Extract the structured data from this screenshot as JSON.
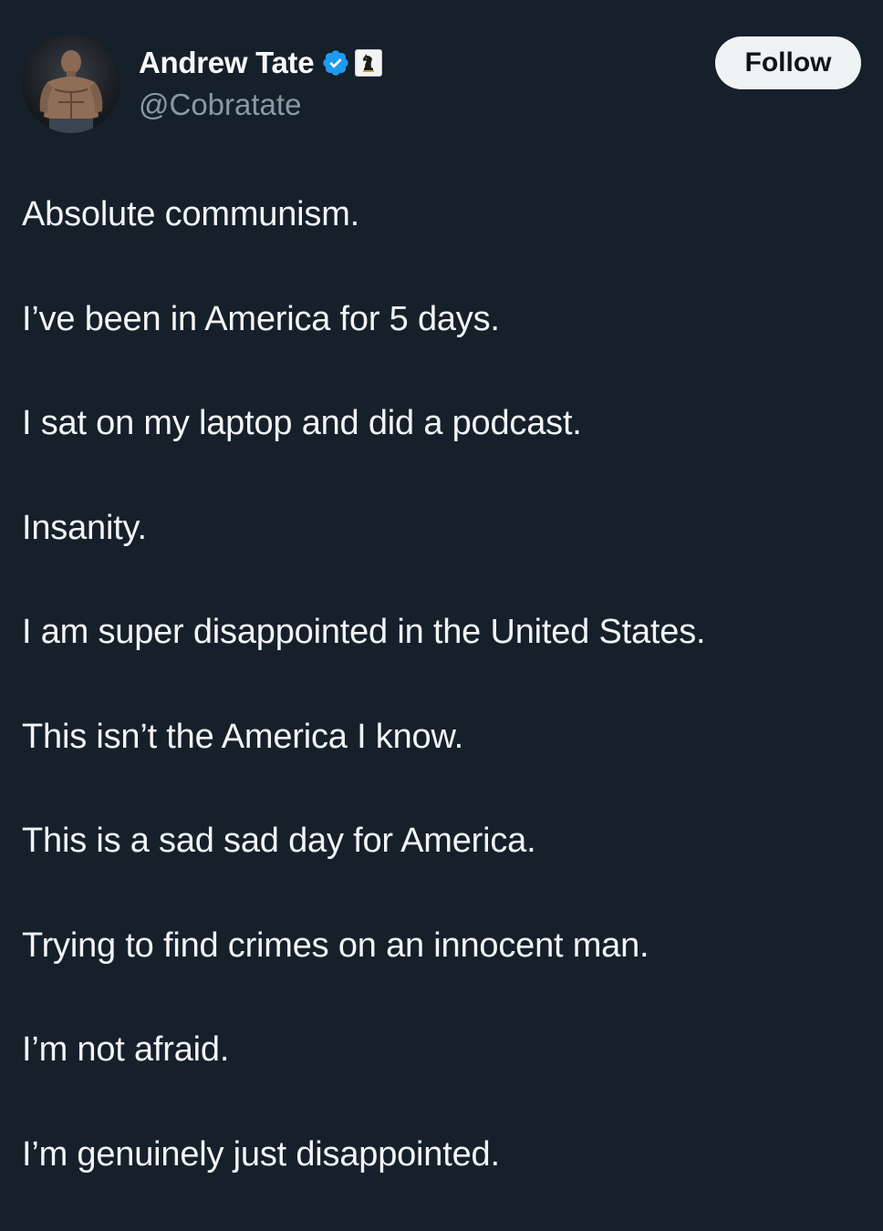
{
  "author": {
    "display_name": "Andrew Tate",
    "handle": "@Cobratate",
    "verified_icon": "verified-badge-icon",
    "affiliation_icon": "chess-knight-badge-icon",
    "accent_color": "#1d9bf0"
  },
  "actions": {
    "follow_label": "Follow"
  },
  "tweet": {
    "paragraphs": [
      "Absolute communism.",
      "I’ve been in America for 5 days.",
      "I sat on my laptop and did a podcast.",
      "Insanity.",
      "I am super disappointed in the United States.",
      "This isn’t the America I know.",
      "This is a sad sad day for America.",
      "Trying to find crimes on an innocent man.",
      "I’m not afraid.",
      "I’m genuinely just disappointed."
    ]
  },
  "colors": {
    "background": "#15202b",
    "text": "#e7e9ea",
    "secondary_text": "#8b98a5",
    "follow_button_bg": "#eff3f4"
  }
}
